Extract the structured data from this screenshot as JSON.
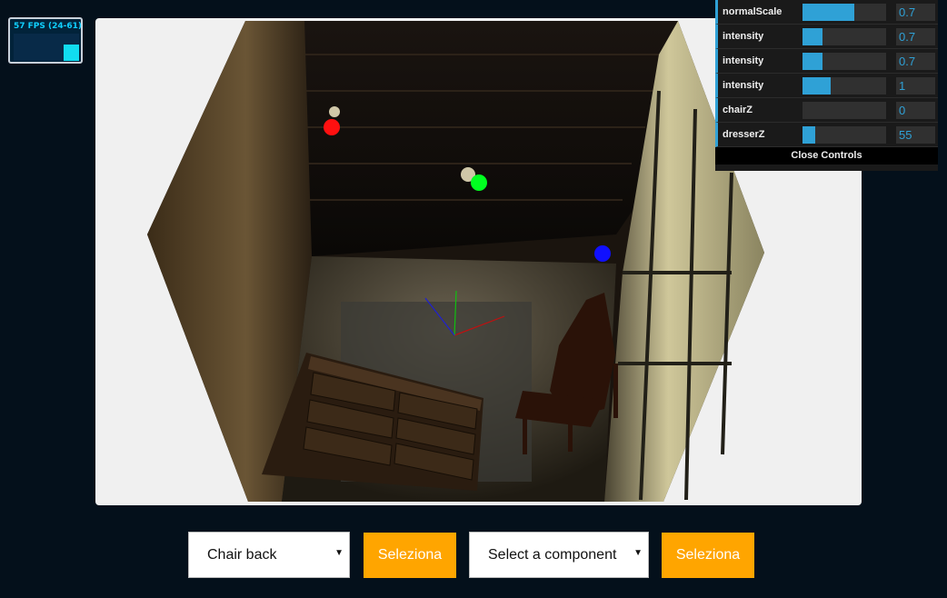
{
  "stats": {
    "fps_text": "57 FPS (24-61)"
  },
  "gui": {
    "rows": [
      {
        "label": "normalScale",
        "value": "0.7",
        "fill": 0.62
      },
      {
        "label": "intensity",
        "value": "0.7",
        "fill": 0.24
      },
      {
        "label": "intensity",
        "value": "0.7",
        "fill": 0.24
      },
      {
        "label": "intensity",
        "value": "1",
        "fill": 0.34
      },
      {
        "label": "chairZ",
        "value": "0",
        "fill": 0
      },
      {
        "label": "dresserZ",
        "value": "55",
        "fill": 0.15
      }
    ],
    "close_label": "Close Controls",
    "accent": "#2fa1d6"
  },
  "scene": {
    "lights": [
      {
        "name": "red-light",
        "color": "#ff1010"
      },
      {
        "name": "green-light",
        "color": "#00ff20"
      },
      {
        "name": "blue-light",
        "color": "#1010ff"
      }
    ]
  },
  "controls": {
    "select1": {
      "value": "Chair back"
    },
    "button1": {
      "label": "Seleziona"
    },
    "select2": {
      "value": "Select a component"
    },
    "button2": {
      "label": "Seleziona"
    },
    "button_color": "#ffa500"
  }
}
